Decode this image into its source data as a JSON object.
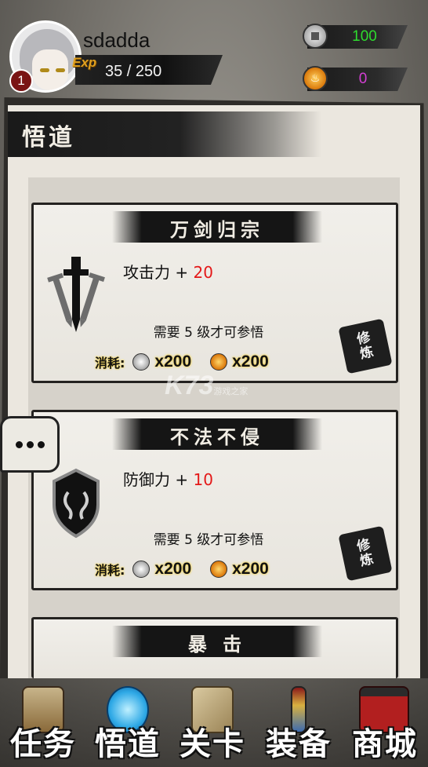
{
  "player": {
    "name": "sdadda",
    "level": "1",
    "exp_label": "Exp",
    "exp_text": "35 / 250"
  },
  "currency": {
    "silver": "100",
    "gold": "0"
  },
  "colors": {
    "silver_value": "#2edb2e",
    "gold_value": "#d43fd4",
    "bonus": "#e41818"
  },
  "panel": {
    "title": "悟道"
  },
  "skills": [
    {
      "name": "万剑归宗",
      "stat_label": "攻击力 + ",
      "stat_bonus": "20",
      "requirement": "需要 5 级才可参悟",
      "cost_label": "消耗:",
      "silver_cost": "x200",
      "gold_cost": "x200",
      "refine_top": "修",
      "refine_bottom": "炼",
      "icon": "sword-icon"
    },
    {
      "name": "不法不侵",
      "stat_label": "防御力 + ",
      "stat_bonus": "10",
      "requirement": "需要 5 级才可参悟",
      "cost_label": "消耗:",
      "silver_cost": "x200",
      "gold_cost": "x200",
      "refine_top": "修",
      "refine_bottom": "炼",
      "icon": "shield-icon"
    },
    {
      "name": "暴 击"
    }
  ],
  "watermark": {
    "text": "K73",
    "sub": "游戏之家"
  },
  "nav": [
    {
      "label": "任务",
      "icon": "scroll-icon"
    },
    {
      "label": "悟道",
      "icon": "yin-yang-icon"
    },
    {
      "label": "关卡",
      "icon": "map-icon"
    },
    {
      "label": "装备",
      "icon": "sword-icon"
    },
    {
      "label": "商城",
      "icon": "pagoda-icon"
    }
  ]
}
